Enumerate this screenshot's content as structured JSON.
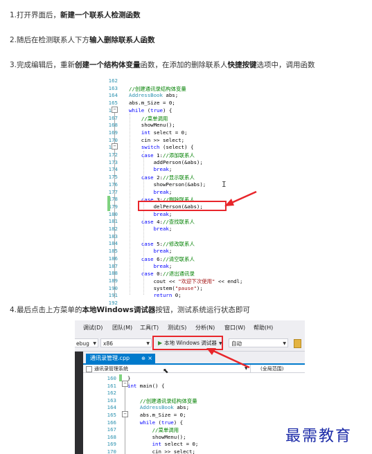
{
  "steps": [
    {
      "pre": "1.打开界面后，",
      "bold": "新建一个联系人检测函数",
      "post": ""
    },
    {
      "pre": "2.随后在检测联系人下方",
      "bold": "输入删除联系人函数",
      "post": ""
    },
    {
      "pre": "3.完成编辑后，重新",
      "bold": "创建一个结构体变量",
      "post": "函数，在添加的删除联系人",
      "bold2": "快捷按键",
      "post2": "选项中，调用函数"
    },
    {
      "pre": "4.最后点击上方菜单的",
      "bold": "本地Windows调试器",
      "post": "按钮，测试系统运行状态即可"
    }
  ],
  "code1": {
    "line_numbers": [
      "162",
      "163",
      "164",
      "165",
      "166",
      "167",
      "168",
      "169",
      "170",
      "171",
      "172",
      "173",
      "174",
      "175",
      "176",
      "177",
      "178",
      "179",
      "180",
      "181",
      "182",
      "183",
      "184",
      "185",
      "186",
      "187",
      "188",
      "189",
      "190",
      "191",
      "192"
    ],
    "lines": [
      [],
      [
        {
          "t": "//创建通讯录结构体变量",
          "c": "cm"
        }
      ],
      [
        {
          "t": "AddressBook",
          "c": "ty"
        },
        {
          "t": " abs;",
          "c": ""
        }
      ],
      [
        {
          "t": "abs.m_Size = 0;",
          "c": ""
        }
      ],
      [
        {
          "t": "while",
          "c": "kw"
        },
        {
          "t": " (",
          "c": ""
        },
        {
          "t": "true",
          "c": "kw"
        },
        {
          "t": ") {",
          "c": ""
        }
      ],
      [
        {
          "t": "    ",
          "c": ""
        },
        {
          "t": "//菜单调用",
          "c": "cm"
        }
      ],
      [
        {
          "t": "    showMenu();",
          "c": ""
        }
      ],
      [
        {
          "t": "    ",
          "c": ""
        },
        {
          "t": "int",
          "c": "kw"
        },
        {
          "t": " select = 0;",
          "c": ""
        }
      ],
      [
        {
          "t": "    cin >> select;",
          "c": ""
        }
      ],
      [
        {
          "t": "    ",
          "c": ""
        },
        {
          "t": "switch",
          "c": "kw"
        },
        {
          "t": " (select) {",
          "c": ""
        }
      ],
      [
        {
          "t": "    ",
          "c": ""
        },
        {
          "t": "case",
          "c": "kw"
        },
        {
          "t": " 1:",
          "c": ""
        },
        {
          "t": "//添加联系人",
          "c": "cm"
        }
      ],
      [
        {
          "t": "        addPerson(&abs);",
          "c": ""
        }
      ],
      [
        {
          "t": "        ",
          "c": ""
        },
        {
          "t": "break",
          "c": "kw"
        },
        {
          "t": ";",
          "c": ""
        }
      ],
      [
        {
          "t": "    ",
          "c": ""
        },
        {
          "t": "case",
          "c": "kw"
        },
        {
          "t": " 2:",
          "c": ""
        },
        {
          "t": "//显示联系人",
          "c": "cm"
        }
      ],
      [
        {
          "t": "        showPerson(&abs);",
          "c": ""
        }
      ],
      [
        {
          "t": "        ",
          "c": ""
        },
        {
          "t": "break",
          "c": "kw"
        },
        {
          "t": ";",
          "c": ""
        }
      ],
      [
        {
          "t": "    ",
          "c": ""
        },
        {
          "t": "case",
          "c": "kw"
        },
        {
          "t": " 3:",
          "c": ""
        },
        {
          "t": "//删除联系人",
          "c": "cm"
        }
      ],
      [
        {
          "t": "        delPerson(&abs);",
          "c": ""
        }
      ],
      [
        {
          "t": "        ",
          "c": ""
        },
        {
          "t": "break",
          "c": "kw"
        },
        {
          "t": ";",
          "c": ""
        }
      ],
      [
        {
          "t": "    ",
          "c": ""
        },
        {
          "t": "case",
          "c": "kw"
        },
        {
          "t": " 4:",
          "c": ""
        },
        {
          "t": "//查找联系人",
          "c": "cm"
        }
      ],
      [
        {
          "t": "        ",
          "c": ""
        },
        {
          "t": "break",
          "c": "kw"
        },
        {
          "t": ";",
          "c": ""
        }
      ],
      [],
      [
        {
          "t": "    ",
          "c": ""
        },
        {
          "t": "case",
          "c": "kw"
        },
        {
          "t": " 5:",
          "c": ""
        },
        {
          "t": "//修改联系人",
          "c": "cm"
        }
      ],
      [
        {
          "t": "        ",
          "c": ""
        },
        {
          "t": "break",
          "c": "kw"
        },
        {
          "t": ";",
          "c": ""
        }
      ],
      [
        {
          "t": "    ",
          "c": ""
        },
        {
          "t": "case",
          "c": "kw"
        },
        {
          "t": " 6:",
          "c": ""
        },
        {
          "t": "//清空联系人",
          "c": "cm"
        }
      ],
      [
        {
          "t": "        ",
          "c": ""
        },
        {
          "t": "break",
          "c": "kw"
        },
        {
          "t": ";",
          "c": ""
        }
      ],
      [
        {
          "t": "    ",
          "c": ""
        },
        {
          "t": "case",
          "c": "kw"
        },
        {
          "t": " 0:",
          "c": ""
        },
        {
          "t": "//退出通讯录",
          "c": "cm"
        }
      ],
      [
        {
          "t": "        cout << ",
          "c": ""
        },
        {
          "t": "\"欢迎下次使用\"",
          "c": "st"
        },
        {
          "t": " << endl;",
          "c": ""
        }
      ],
      [
        {
          "t": "        system(",
          "c": ""
        },
        {
          "t": "\"pause\"",
          "c": "st"
        },
        {
          "t": ");",
          "c": ""
        }
      ],
      [
        {
          "t": "        ",
          "c": ""
        },
        {
          "t": "return",
          "c": "kw"
        },
        {
          "t": " 0;",
          "c": ""
        }
      ],
      []
    ]
  },
  "ide": {
    "menu": [
      "调试(D)",
      "团队(M)",
      "工具(T)",
      "测试(S)",
      "分析(N)",
      "窗口(W)",
      "帮助(H)"
    ],
    "config_value": "ebug",
    "platform_value": "x86",
    "run_label": "本地 Windows 调试器",
    "run_mode_value": "自动",
    "tab_label": "通讯录管理.cpp",
    "tab_pin": "⊕",
    "tab_close": "×",
    "nav_scope": "通讯录管理系统",
    "nav_global": "(全局范围)",
    "line_numbers": [
      "160",
      "161",
      "162",
      "163",
      "164",
      "165",
      "166",
      "167",
      "168",
      "169",
      "170"
    ],
    "lines": [
      [
        {
          "t": "}",
          "c": ""
        }
      ],
      [
        {
          "t": "int",
          "c": "kw"
        },
        {
          "t": " main() {",
          "c": ""
        }
      ],
      [],
      [
        {
          "t": "    ",
          "c": ""
        },
        {
          "t": "//创建通讯录结构体变量",
          "c": "cm"
        }
      ],
      [
        {
          "t": "    ",
          "c": ""
        },
        {
          "t": "AddressBook",
          "c": "ty"
        },
        {
          "t": " abs;",
          "c": ""
        }
      ],
      [
        {
          "t": "    abs.m_Size = 0;",
          "c": ""
        }
      ],
      [
        {
          "t": "    ",
          "c": ""
        },
        {
          "t": "while",
          "c": "kw"
        },
        {
          "t": " (",
          "c": ""
        },
        {
          "t": "true",
          "c": "kw"
        },
        {
          "t": ") {",
          "c": ""
        }
      ],
      [
        {
          "t": "        ",
          "c": ""
        },
        {
          "t": "//菜单调用",
          "c": "cm"
        }
      ],
      [
        {
          "t": "        showMenu();",
          "c": ""
        }
      ],
      [
        {
          "t": "        ",
          "c": ""
        },
        {
          "t": "int",
          "c": "kw"
        },
        {
          "t": " select = 0;",
          "c": ""
        }
      ],
      [
        {
          "t": "        cin >> select;",
          "c": ""
        }
      ]
    ]
  },
  "watermark": "最需教育",
  "colors": {
    "highlight_red": "#e8262b",
    "vs_blue": "#007acc",
    "watermark": "#1c2ba8"
  }
}
